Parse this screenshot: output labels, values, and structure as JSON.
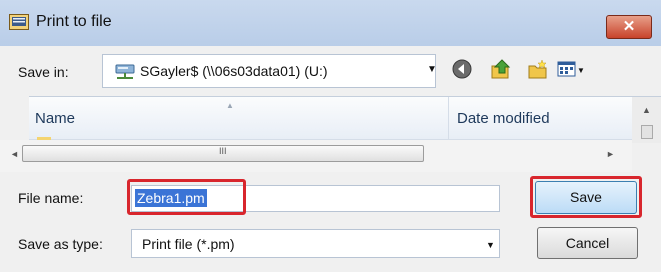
{
  "window": {
    "title": "Print to file",
    "close_glyph": "✕",
    "icon": "printer-dialog-icon"
  },
  "save_in": {
    "label": "Save in:",
    "location": "SGayler$ (\\\\06s03data01) (U:)",
    "location_icon": "network-drive-icon",
    "dropdown_glyph": "▼"
  },
  "toolbar": {
    "back_icon": "back-icon",
    "up_icon": "up-folder-icon",
    "new_folder_icon": "new-folder-icon",
    "views_icon": "views-menu-icon",
    "views_arrow": "▼"
  },
  "file_list": {
    "columns": [
      "Name",
      "Date modified"
    ],
    "sort_glyph": "▲"
  },
  "scrollbars": {
    "left_glyph": "◄",
    "right_glyph": "►",
    "up_glyph": "▲",
    "grip_glyph": "III"
  },
  "file_name": {
    "label": "File name:",
    "value": "Zebra1.pm"
  },
  "save_as_type": {
    "label": "Save as type:",
    "value": "Print file (*.pm)",
    "dropdown_glyph": "▼"
  },
  "buttons": {
    "save": "Save",
    "cancel": "Cancel"
  },
  "colors": {
    "highlight": "#d8262d",
    "selection": "#3b74d6",
    "titlebar": "#c9d9ee"
  }
}
